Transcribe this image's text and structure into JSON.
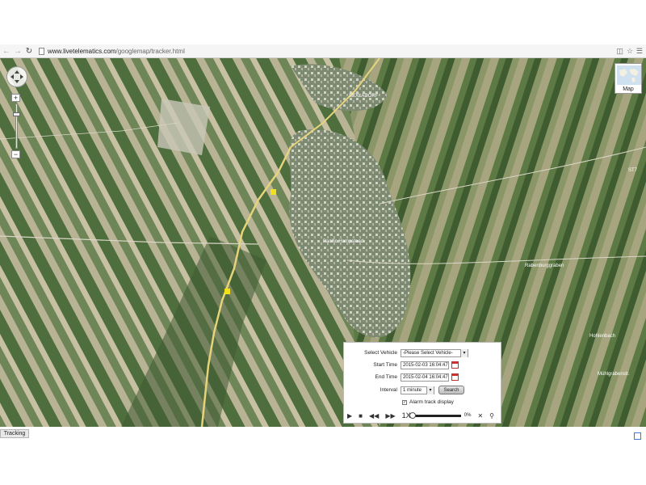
{
  "browser": {
    "url_host": "www.livetelematics.com",
    "url_path": "/googlemap/tracker.html"
  },
  "map": {
    "type_button_label": "Map",
    "labels": {
      "town_north": "SEXLADORF",
      "town_center": "Pacific Hampstead",
      "area_right": "Rabenburggraben",
      "area_right2": "Hohlenbach",
      "road_east": "ST7",
      "road_se": "Mühlgrabenstr."
    }
  },
  "panel": {
    "select_vehicle_label": "Select Vehicle",
    "select_vehicle_value": "-Please Select Vehicle-",
    "start_time_label": "Start Time",
    "start_time_value": "2015-02-03 16:04:47",
    "end_time_label": "End Time",
    "end_time_value": "2015-02-04 16:04:47",
    "interval_label": "Interval",
    "interval_value": "1 minute",
    "search_label": "Search",
    "alarm_label": "Alarm track display",
    "alarm_checked": true,
    "speed": "1X",
    "progress": 0,
    "progress_text": "0%"
  },
  "status": {
    "tab_label": "Tracking"
  }
}
